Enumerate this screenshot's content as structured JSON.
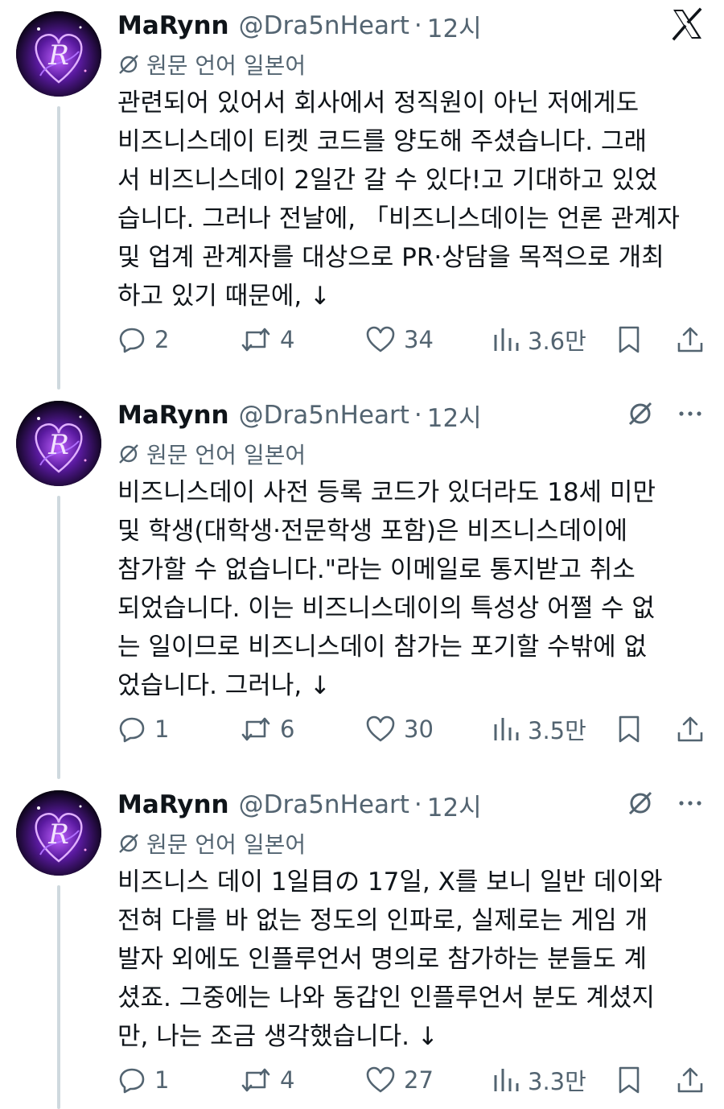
{
  "colors": {
    "text": "#0f1419",
    "muted": "#536471",
    "thread_line": "#cfd9de",
    "avatar_accent": "#8a3bd6"
  },
  "top_icon": "x-logo-icon",
  "tweets": [
    {
      "name": "MaRynn",
      "handle": "@Dra5nHeart",
      "dot": "·",
      "time": "12시",
      "lang": "원문 언어 일본어",
      "lines": [
        "관련되어 있어서 회사에서 정직원이 아닌 저에게도",
        "비즈니스데이 티켓 코드를 양도해 주셨습니다. 그래",
        "서 비즈니스데이 2일간 갈 수 있다!고 기대하고 있었",
        "습니다. 그러나 전날에, 「비즈니스데이는 언론 관계자",
        "및 업계 관계자를 대상으로 PR·상담을 목적으로 개최",
        "하고 있기 때문에, ↓"
      ],
      "replies": "2",
      "reposts": "4",
      "likes": "34",
      "views": "3.6만"
    },
    {
      "name": "MaRynn",
      "handle": "@Dra5nHeart",
      "dot": "·",
      "time": "12시",
      "lang": "원문 언어 일본어",
      "lines": [
        "비즈니스데이 사전 등록 코드가 있더라도 18세 미만",
        "및 학생(대학생·전문학생 포함)은 비즈니스데이에",
        "참가할 수 없습니다.\"라는 이메일로 통지받고 취소",
        "되었습니다. 이는 비즈니스데이의 특성상 어쩔 수 없",
        "는 일이므로 비즈니스데이 참가는 포기할 수밖에 없",
        "었습니다. 그러나, ↓"
      ],
      "replies": "1",
      "reposts": "6",
      "likes": "30",
      "views": "3.5만"
    },
    {
      "name": "MaRynn",
      "handle": "@Dra5nHeart",
      "dot": "·",
      "time": "12시",
      "lang": "원문 언어 일본어",
      "lines": [
        "비즈니스 데이 1일目の 17일, X를 보니 일반 데이와",
        "전혀 다를 바 없는 정도의 인파로, 실제로는 게임 개",
        "발자 외에도 인플루언서 명의로 참가하는 분들도 계",
        "셨죠. 그중에는 나와 동갑인 인플루언서 분도 계셨지",
        "만, 나는 조금 생각했습니다. ↓"
      ],
      "replies": "1",
      "reposts": "4",
      "likes": "27",
      "views": "3.3만"
    }
  ]
}
